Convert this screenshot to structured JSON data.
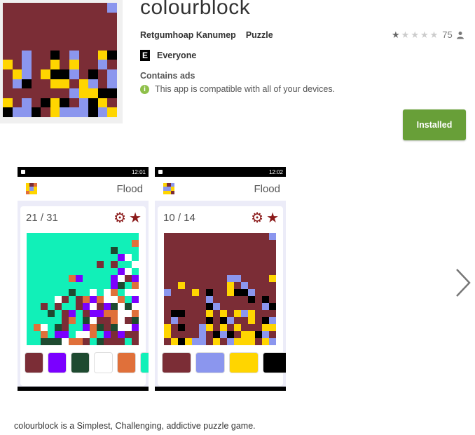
{
  "app": {
    "title": "colourblock",
    "developer": "Retgumhoap Kanumep",
    "category": "Puzzle",
    "rating_count": "75",
    "rating_stars_filled": 1.5,
    "content_rating": "Everyone",
    "content_rating_badge": "E",
    "ads_label": "Contains ads",
    "compat_text": "This app is compatible with all of your devices.",
    "install_label": "Installed",
    "description": "colourblock is a Simplest, Challenging, addictive puzzle game."
  },
  "colors": {
    "install_button": "#689f38",
    "maroon": "#7b2d36",
    "periwinkle": "#8b96ee",
    "yellow": "#ffd500",
    "black": "#000000",
    "teal": "#11f0b8",
    "orange": "#e0703a",
    "purple": "#7b00ff",
    "darkgreen": "#1e4a30",
    "white": "#ffffff"
  },
  "icons": [
    "star-icon",
    "person-icon",
    "info-icon",
    "gear-icon",
    "chevron-right-icon"
  ],
  "screenshots": [
    {
      "status_time": "12:01",
      "mode": "Flood",
      "counter": "21 / 31",
      "palette": [
        "#7b2d36",
        "#7b00ff",
        "#1e4a30",
        "#ffffff",
        "#e0703a",
        "#11f0b8"
      ]
    },
    {
      "status_time": "12:02",
      "mode": "Flood",
      "counter": "10 / 14",
      "palette": [
        "#7b2d36",
        "#8b96ee",
        "#ffd500",
        "#000000"
      ]
    }
  ]
}
